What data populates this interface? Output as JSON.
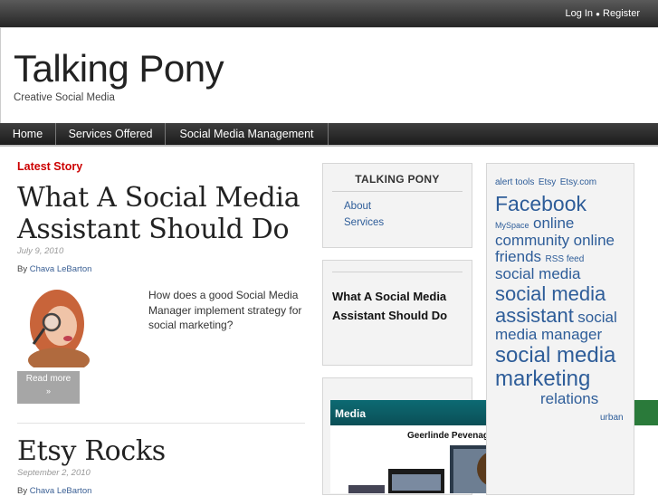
{
  "topbar": {
    "login_label": "Log In",
    "separator": "●",
    "register_label": "Register"
  },
  "header": {
    "site_title": "Talking Pony",
    "tagline": "Creative Social Media"
  },
  "nav": {
    "items": [
      {
        "label": "Home"
      },
      {
        "label": "Services Offered"
      },
      {
        "label": "Social Media Management"
      }
    ]
  },
  "main": {
    "latest_label": "Latest Story",
    "posts": [
      {
        "title_line1": "What A Social Media",
        "title_line2": "Assistant Should Do",
        "date": "July 9, 2010",
        "by_prefix": "By",
        "author": "Chava LeBarton",
        "excerpt": "How does a good Social Media Manager implement strategy for social marketing?",
        "readmore_label": "Read more",
        "readmore_arrow": "»"
      },
      {
        "title_line1": "Etsy Rocks",
        "date": "September 2, 2010",
        "by_prefix": "By",
        "author": "Chava LeBarton"
      }
    ]
  },
  "sidebar": {
    "pages_widget": {
      "title": "TALKING PONY",
      "links": [
        "About",
        "Services"
      ]
    },
    "recent_widget": {
      "line1": "What A Social Media",
      "line2": "Assistant Should Do"
    },
    "media_widget": {
      "title": "Media",
      "caption": "Geerlinde Pevenage (uk) : about the..."
    }
  },
  "tagcloud": {
    "tags": [
      {
        "text": "alert tools",
        "size": 10
      },
      {
        "text": "Etsy",
        "size": 10
      },
      {
        "text": "Etsy.com",
        "size": 10
      },
      {
        "text": "Facebook",
        "size": 23
      },
      {
        "text": "MySpace",
        "size": 9
      },
      {
        "text": "online",
        "size": 17
      },
      {
        "text": "community",
        "size": 17
      },
      {
        "text": "online",
        "size": 17
      },
      {
        "text": "friends",
        "size": 17
      },
      {
        "text": "RSS feed",
        "size": 10
      },
      {
        "text": "social media",
        "size": 17
      },
      {
        "text": "social media",
        "size": 22
      },
      {
        "text": "assistant",
        "size": 22
      },
      {
        "text": "social",
        "size": 17
      },
      {
        "text": "media manager",
        "size": 17
      },
      {
        "text": "social media",
        "size": 24
      },
      {
        "text": "marketing",
        "size": 24
      },
      {
        "text": "relations",
        "size": 17
      },
      {
        "text": "urban",
        "size": 10
      }
    ]
  },
  "colors": {
    "accent_red": "#cc0000",
    "link_blue": "#2e5d99",
    "nav_dark": "#262626",
    "media_teal": "#0c6a73"
  }
}
